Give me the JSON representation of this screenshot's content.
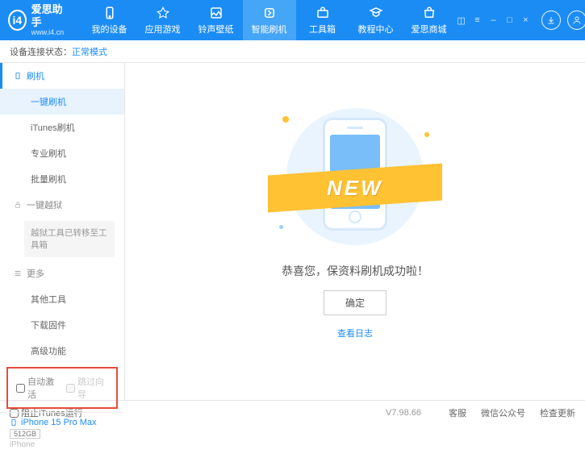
{
  "header": {
    "app_title": "爱思助手",
    "app_sub": "www.i4.cn",
    "nav": [
      {
        "label": "我的设备"
      },
      {
        "label": "应用游戏"
      },
      {
        "label": "铃声壁纸"
      },
      {
        "label": "智能刷机"
      },
      {
        "label": "工具箱"
      },
      {
        "label": "教程中心"
      },
      {
        "label": "爱思商城"
      }
    ]
  },
  "status": {
    "label": "设备连接状态：",
    "value": "正常模式"
  },
  "sidebar": {
    "flash_section": "刷机",
    "items_flash": [
      {
        "label": "一键刷机"
      },
      {
        "label": "iTunes刷机"
      },
      {
        "label": "专业刷机"
      },
      {
        "label": "批量刷机"
      }
    ],
    "jailbreak_section": "一键越狱",
    "jailbreak_note": "越狱工具已转移至工具箱",
    "more_section": "更多",
    "items_more": [
      {
        "label": "其他工具"
      },
      {
        "label": "下载固件"
      },
      {
        "label": "高级功能"
      }
    ],
    "checkboxes": {
      "auto_activate": "自动激活",
      "skip_setup": "跳过向导"
    },
    "device": {
      "name": "iPhone 15 Pro Max",
      "storage": "512GB",
      "type": "iPhone"
    }
  },
  "main": {
    "ribbon": "NEW",
    "message": "恭喜您，保资料刷机成功啦！",
    "ok": "确定",
    "view_log": "查看日志"
  },
  "footer": {
    "block_itunes": "阻止iTunes运行",
    "version": "V7.98.66",
    "links": [
      "客服",
      "微信公众号",
      "检查更新"
    ]
  }
}
